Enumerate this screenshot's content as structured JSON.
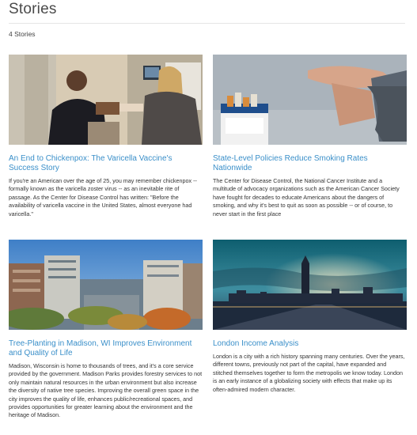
{
  "page": {
    "title": "Stories",
    "count_label": "4 Stories"
  },
  "stories": [
    {
      "title": "An End to Chickenpox: The Varicella Vaccine's Success Story",
      "description": "If you're an American over the age of 25, you may remember chickenpox -- formally known as the varicella zoster virus -- as an inevitable rite of passage. As the Center for Disease Control has written: \"Before the availability of varicella vaccine in the United States, almost everyone had varicella.\""
    },
    {
      "title": "State-Level Policies Reduce Smoking Rates Nationwide",
      "description": "The Center for Disease Control, the National Cancer Institute and a multitude of advocacy organizations such as the American Cancer Society have fought for decades to educate Americans about the dangers of smoking, and why it's best to quit as soon as possible -- or of course, to never start in the first place"
    },
    {
      "title": "Tree-Planting in Madison, WI Improves Environment and Quality of Life",
      "description": "Madison, Wisconsin is home to thousands of trees, and it's a core service provided by the government. Madison Parks provides forestry services to not only maintain natural resources in the urban environment but also increase the diversity of native tree species. Improving the overall green space in the city improves the quality of life, enhances public/recreational spaces, and provides opportunities for greater learning about the environment and the heritage of Madison."
    },
    {
      "title": "London Income Analysis",
      "description": "London is a city with a rich history spanning many centuries. Over the years, different towns, previously not part of the capital, have expanded and stitched themselves together to form the metropolis we know today. London is an early instance of a globalizing society with effects that make up its often-admired modern character."
    }
  ]
}
